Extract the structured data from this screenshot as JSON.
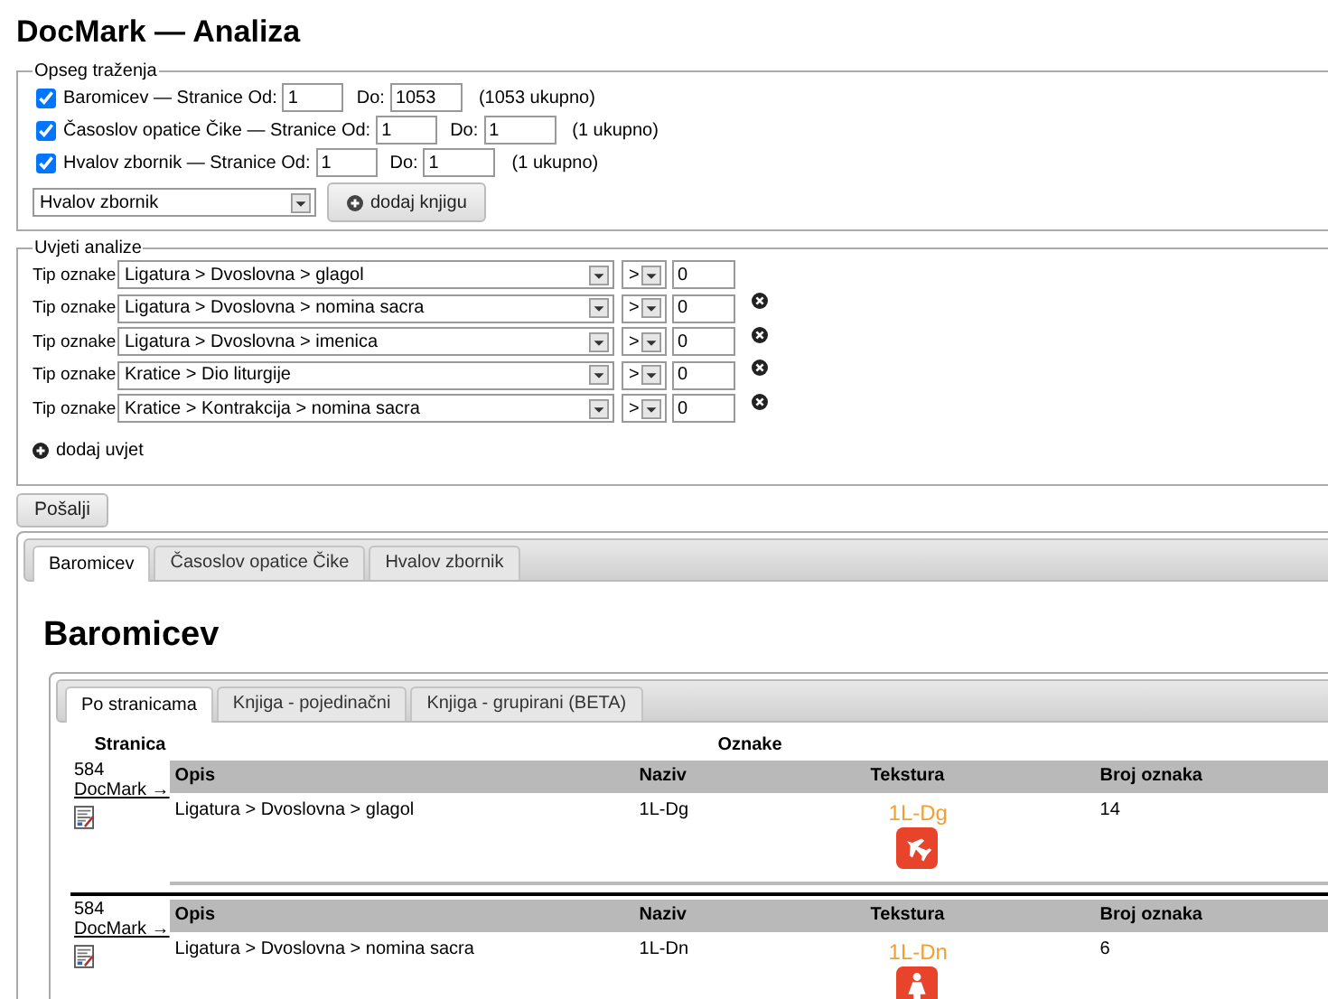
{
  "title": "DocMark — Analiza",
  "scope": {
    "legend": "Opseg traženja",
    "books": [
      {
        "checked": true,
        "name": "Baromicev — Stranice Od:",
        "from": "1",
        "to_label": "Do:",
        "to": "1053",
        "total": "(1053 ukupno)"
      },
      {
        "checked": true,
        "name": "Časoslov opatice Čike — Stranice Od:",
        "from": "1",
        "to_label": "Do:",
        "to": "1",
        "total": "(1 ukupno)"
      },
      {
        "checked": true,
        "name": "Hvalov zbornik — Stranice Od:",
        "from": "1",
        "to_label": "Do:",
        "to": "1",
        "total": "(1 ukupno)"
      }
    ],
    "select_value": "Hvalov zbornik",
    "add_button": "dodaj knjigu"
  },
  "conditions": {
    "legend": "Uvjeti analize",
    "rows": [
      {
        "label": "Tip oznake",
        "type": "Ligatura > Dvoslovna > glagol",
        "operator": ">",
        "value": "0",
        "removable": false
      },
      {
        "label": "Tip oznake",
        "type": "Ligatura > Dvoslovna > nomina sacra",
        "operator": ">",
        "value": "0",
        "removable": true
      },
      {
        "label": "Tip oznake",
        "type": "Ligatura > Dvoslovna > imenica",
        "operator": ">",
        "value": "0",
        "removable": true
      },
      {
        "label": "Tip oznake",
        "type": "Kratice > Dio liturgije",
        "operator": ">",
        "value": "0",
        "removable": true
      },
      {
        "label": "Tip oznake",
        "type": "Kratice > Kontrakcija > nomina sacra",
        "operator": ">",
        "value": "0",
        "removable": true
      }
    ],
    "add_label": "dodaj uvjet"
  },
  "submit": "Pošalji",
  "book_tabs": [
    {
      "label": "Baromicev",
      "selected": true
    },
    {
      "label": "Časoslov opatice Čike",
      "selected": false
    },
    {
      "label": "Hvalov zbornik",
      "selected": false
    }
  ],
  "heading": "Baromicev",
  "view_tabs": [
    {
      "label": "Po stranicama",
      "selected": true
    },
    {
      "label": "Knjiga - pojedinačni",
      "selected": false
    },
    {
      "label": "Knjiga - grupirani (BETA)",
      "selected": false
    }
  ],
  "results": {
    "col_page": "Stranica",
    "col_marks": "Oznake",
    "rows": [
      {
        "page": "584",
        "link": "DocMark →",
        "headers": [
          "Opis",
          "Naziv",
          "Tekstura",
          "Broj oznaka"
        ],
        "opis": "Ligatura > Dvoslovna > glagol",
        "naziv": "1L-Dg",
        "tekstura": "1L-Dg",
        "kind": "plane",
        "broj": "14"
      },
      {
        "page": "584",
        "link": "DocMark →",
        "headers": [
          "Opis",
          "Naziv",
          "Tekstura",
          "Broj oznaka"
        ],
        "opis": "Ligatura > Dvoslovna > nomina sacra",
        "naziv": "1L-Dn",
        "tekstura": "1L-Dn",
        "kind": "figure",
        "broj": "6"
      }
    ]
  }
}
